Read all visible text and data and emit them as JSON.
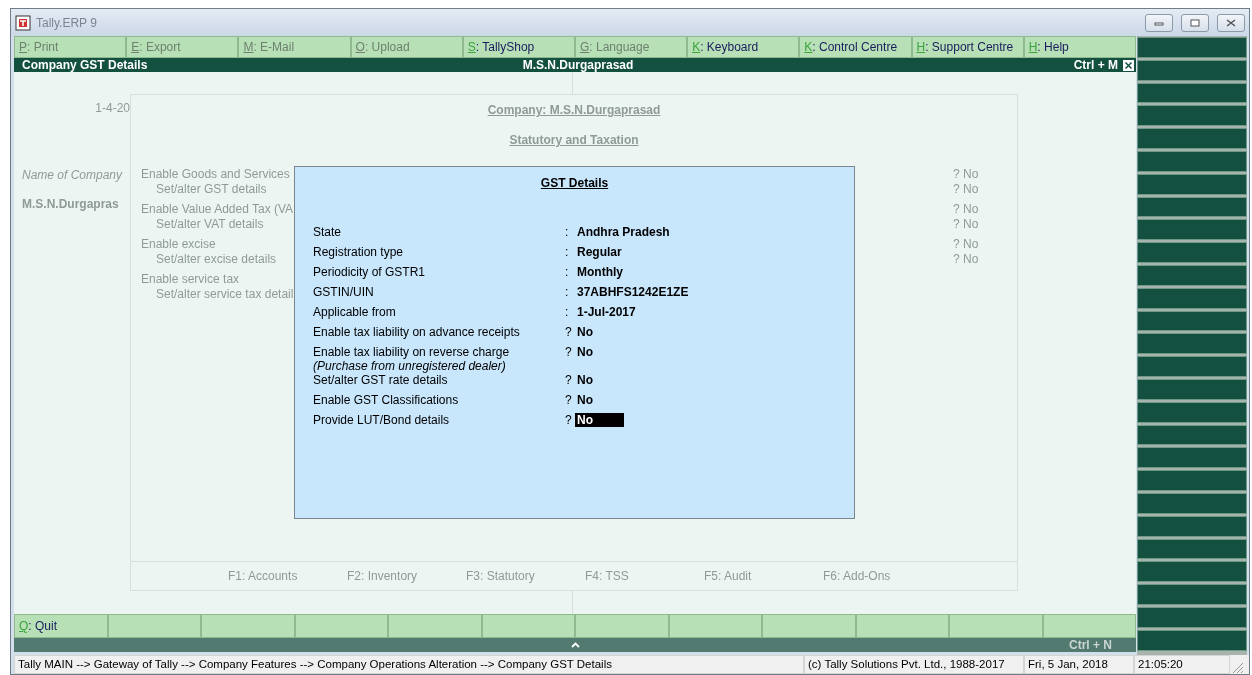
{
  "window": {
    "title": "Tally.ERP 9"
  },
  "menu": [
    {
      "key": "P",
      "sep": ":",
      "label": "Print",
      "disabled": true
    },
    {
      "key": "E",
      "sep": ":",
      "label": "Export",
      "disabled": true
    },
    {
      "key": "M",
      "sep": ":",
      "label": "E-Mail",
      "disabled": true
    },
    {
      "key": "O",
      "sep": ":",
      "label": "Upload",
      "disabled": true
    },
    {
      "key": "S",
      "sep": ":",
      "label": "TallyShop",
      "disabled": false
    },
    {
      "key": "G",
      "sep": ":",
      "label": "Language",
      "disabled": true
    },
    {
      "key": "K",
      "sep": ":",
      "label": "Keyboard",
      "disabled": false
    },
    {
      "key": "K",
      "sep": ":",
      "label": "Control Centre",
      "disabled": false
    },
    {
      "key": "H",
      "sep": ":",
      "label": "Support Centre",
      "disabled": false
    },
    {
      "key": "H",
      "sep": ":",
      "label": "Help",
      "disabled": false
    }
  ],
  "header": {
    "title": "Company GST Details",
    "company": "M.S.N.Durgaprasad",
    "shortcut": "Ctrl + M"
  },
  "background": {
    "period": "1-4-20",
    "name_label": "Name of Company",
    "name": "M.S.N.Durgapras",
    "company_heading": "Company:  M.S.N.Durgaprasad",
    "section": "Statutory and Taxation",
    "groups": [
      {
        "label": "Enable Goods and Services",
        "value": "? No",
        "children": [
          {
            "label": "Set/alter GST details",
            "value": "? No"
          }
        ]
      },
      {
        "label": "Enable Value Added Tax (VA",
        "value": "? No",
        "children": [
          {
            "label": "Set/alter VAT details",
            "value": "? No"
          }
        ]
      },
      {
        "label": "Enable excise",
        "value": "? No",
        "children": [
          {
            "label": "Set/alter excise details",
            "value": "? No"
          }
        ]
      },
      {
        "label": "Enable service tax",
        "children": [
          {
            "label": "Set/alter service tax detail"
          }
        ]
      }
    ],
    "fkeys": [
      {
        "key": "F1:",
        "label": "Accounts"
      },
      {
        "key": "F2:",
        "label": "Inventory"
      },
      {
        "key": "F3:",
        "label": "Statutory"
      },
      {
        "key": "F4:",
        "label": "TSS"
      },
      {
        "key": "F5:",
        "label": "Audit"
      },
      {
        "key": "F6:",
        "label": "Add-Ons"
      }
    ]
  },
  "dialog": {
    "title": "GST Details",
    "rows": [
      {
        "label": "State",
        "sep": ":",
        "value": "Andhra Pradesh",
        "selected": false
      },
      {
        "label": "Registration type",
        "sep": ":",
        "value": "Regular",
        "selected": false
      },
      {
        "label": "Periodicity of GSTR1",
        "sep": ":",
        "value": "Monthly",
        "selected": false
      },
      {
        "label": "GSTIN/UIN",
        "sep": ":",
        "value": "37ABHFS1242E1ZE",
        "selected": false
      },
      {
        "label": "Applicable from",
        "sep": ":",
        "value": "1-Jul-2017",
        "selected": false
      },
      {
        "label": "Enable tax liability on advance receipts",
        "sep": "?",
        "value": "No",
        "selected": false
      },
      {
        "label": "Enable tax liability on reverse charge",
        "note": "(Purchase from unregistered dealer)",
        "sep": "?",
        "value": "No",
        "selected": false
      },
      {
        "label": "Set/alter GST rate details",
        "sep": "?",
        "value": "No",
        "selected": false
      },
      {
        "label": "Enable GST Classifications",
        "sep": "?",
        "value": "No",
        "selected": false
      },
      {
        "label": "Provide LUT/Bond details",
        "sep": "?",
        "value": "No",
        "selected": true
      }
    ]
  },
  "bottom_bar": [
    {
      "key": "Q",
      "sep": ":",
      "label": "Quit"
    }
  ],
  "bottom_shortcut": "Ctrl + N",
  "status_bar": {
    "path": "Tally MAIN --> Gateway of Tally --> Company Features --> Company Operations  Alteration --> Company GST Details",
    "copyright": "(c) Tally Solutions Pvt. Ltd., 1988-2017",
    "date": "Fri, 5 Jan, 2018",
    "time": "21:05:20"
  }
}
